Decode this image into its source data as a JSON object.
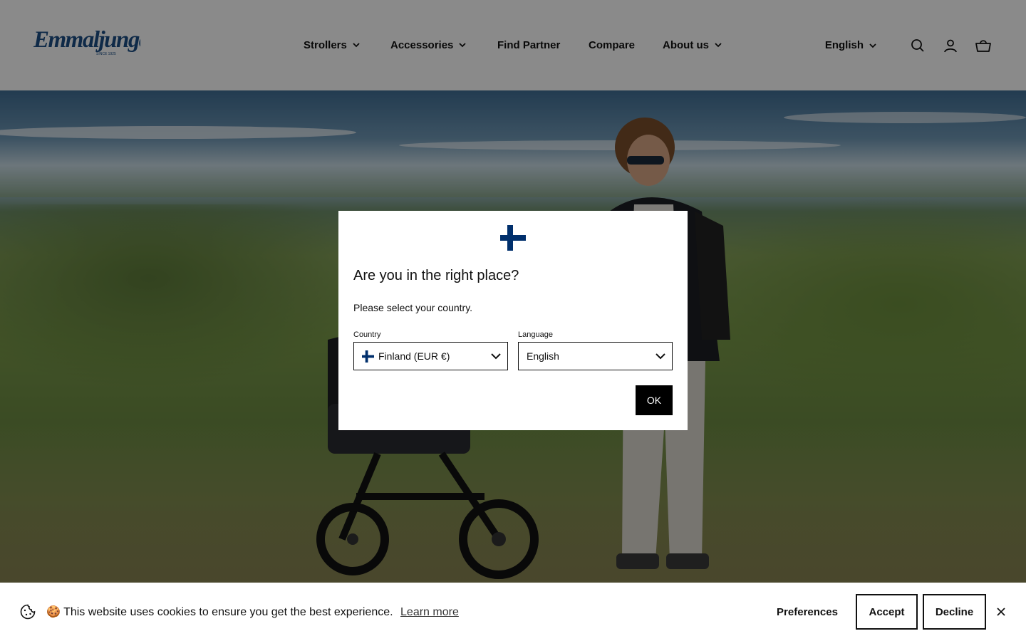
{
  "header": {
    "logo_text": "Emmaljunga",
    "logo_tagline": "SINCE 1925",
    "brand_color": "#1c4f86",
    "nav": [
      {
        "label": "Strollers",
        "has_dropdown": true
      },
      {
        "label": "Accessories",
        "has_dropdown": true
      },
      {
        "label": "Find Partner",
        "has_dropdown": false
      },
      {
        "label": "Compare",
        "has_dropdown": false
      },
      {
        "label": "About us",
        "has_dropdown": true
      }
    ],
    "language_label": "English",
    "icons": [
      "search-icon",
      "account-icon",
      "cart-icon"
    ]
  },
  "modal": {
    "flag_icon": "finland-flag-icon",
    "flag_color": "#002f6c",
    "title": "Are you in the right place?",
    "subtitle": "Please select your country.",
    "country_label": "Country",
    "country_value": "Finland (EUR €)",
    "language_label": "Language",
    "language_value": "English",
    "ok_label": "OK"
  },
  "cookie_bar": {
    "icon": "cookie-icon",
    "emoji": "🍪",
    "message": "This website uses cookies to ensure you get the best experience.",
    "learn_more": "Learn more",
    "preferences_label": "Preferences",
    "accept_label": "Accept",
    "decline_label": "Decline"
  }
}
